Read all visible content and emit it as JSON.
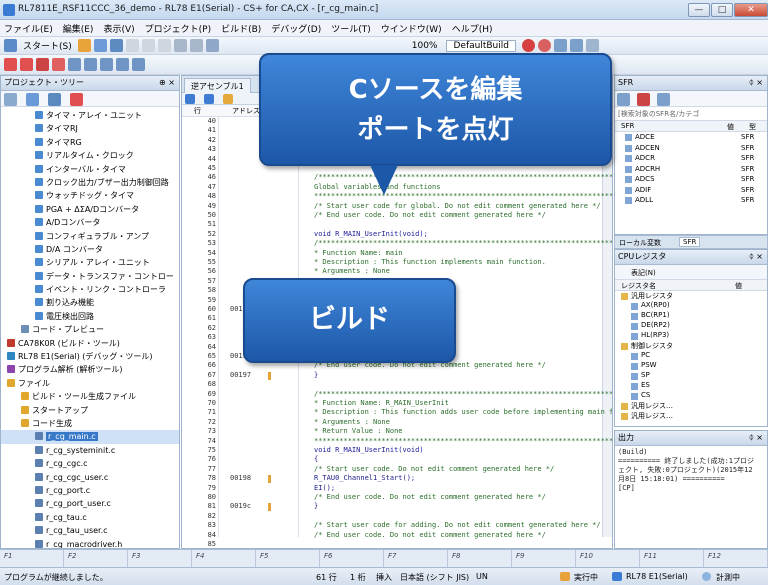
{
  "window": {
    "title": "RL7811E_RSF11CCC_36_demo - RL78 E1(Serial) - CS+ for CA,CX - [r_cg_main.c]",
    "min": "—",
    "max": "□",
    "close": "✕"
  },
  "menu": [
    "ファイル(E)",
    "編集(E)",
    "表示(V)",
    "プロジェクト(P)",
    "ビルド(B)",
    "デバッグ(D)",
    "ツール(T)",
    "ウインドウ(W)",
    "ヘルプ(H)"
  ],
  "toolbar": {
    "start_label": "スタート(S)",
    "zoom": "100%",
    "debug_label": "DefaultBuild"
  },
  "project_tree": {
    "title": "プロジェクト・ツリー",
    "items": [
      {
        "label": "タイマ・アレイ・ユニット",
        "indent": 2,
        "color": "#4a8ad0"
      },
      {
        "label": "タイマRJ",
        "indent": 2,
        "color": "#4a8ad0"
      },
      {
        "label": "タイマRG",
        "indent": 2,
        "color": "#4a8ad0"
      },
      {
        "label": "リアルタイム・クロック",
        "indent": 2,
        "color": "#4a8ad0"
      },
      {
        "label": "インターバル・タイマ",
        "indent": 2,
        "color": "#4a8ad0"
      },
      {
        "label": "クロック出力/ブザー出力制御回路",
        "indent": 2,
        "color": "#4a8ad0"
      },
      {
        "label": "ウォッチドッグ・タイマ",
        "indent": 2,
        "color": "#4a8ad0"
      },
      {
        "label": "PGA + ΔΣA/Dコンバータ",
        "indent": 2,
        "color": "#4a8ad0"
      },
      {
        "label": "A/Dコンバータ",
        "indent": 2,
        "color": "#4a8ad0"
      },
      {
        "label": "コンフィギュラブル・アンプ",
        "indent": 2,
        "color": "#4a8ad0"
      },
      {
        "label": "D/A コンバータ",
        "indent": 2,
        "color": "#4a8ad0"
      },
      {
        "label": "シリアル・アレイ・ユニット",
        "indent": 2,
        "color": "#4a8ad0"
      },
      {
        "label": "データ・トランスファ・コントロー",
        "indent": 2,
        "color": "#4a8ad0"
      },
      {
        "label": "イベント・リンク・コントローラ",
        "indent": 2,
        "color": "#4a8ad0"
      },
      {
        "label": "割り込み機能",
        "indent": 2,
        "color": "#4a8ad0"
      },
      {
        "label": "電圧検出回路",
        "indent": 2,
        "color": "#4a8ad0"
      },
      {
        "label": "コード・プレビュー",
        "indent": 1,
        "color": "#6d8fb5"
      },
      {
        "label": "CA78K0R (ビルド・ツール)",
        "indent": 0,
        "color": "#c0392b"
      },
      {
        "label": "RL78 E1(Serial) (デバッグ・ツール)",
        "indent": 0,
        "color": "#2e86c1"
      },
      {
        "label": "プログラム解析 (解析ツール)",
        "indent": 0,
        "color": "#8e44ad"
      },
      {
        "label": "ファイル",
        "indent": 0,
        "color": "#e1a72c"
      },
      {
        "label": "ビルド・ツール生成ファイル",
        "indent": 1,
        "color": "#e1a72c"
      },
      {
        "label": "スタートアップ",
        "indent": 1,
        "color": "#e1a72c"
      },
      {
        "label": "コード生成",
        "indent": 1,
        "color": "#e1a72c"
      },
      {
        "label": "r_cg_main.c",
        "indent": 2,
        "color": "#5a7fb0",
        "selected": true
      },
      {
        "label": "r_cg_systeminit.c",
        "indent": 2,
        "color": "#5a7fb0"
      },
      {
        "label": "r_cg_cgc.c",
        "indent": 2,
        "color": "#5a7fb0"
      },
      {
        "label": "r_cg_cgc_user.c",
        "indent": 2,
        "color": "#5a7fb0"
      },
      {
        "label": "r_cg_port.c",
        "indent": 2,
        "color": "#5a7fb0"
      },
      {
        "label": "r_cg_port_user.c",
        "indent": 2,
        "color": "#5a7fb0"
      },
      {
        "label": "r_cg_tau.c",
        "indent": 2,
        "color": "#5a7fb0"
      },
      {
        "label": "r_cg_tau_user.c",
        "indent": 2,
        "color": "#5a7fb0"
      },
      {
        "label": "r_cg_macrodriver.h",
        "indent": 2,
        "color": "#5a7fb0"
      }
    ]
  },
  "editor": {
    "tabs": [
      "逆アセンブル1",
      "r_cg_main.c"
    ],
    "header_label": "アドレス",
    "lines": [
      {
        "n": "40",
        "a": "",
        "c": "",
        "k": "code"
      },
      {
        "n": "41",
        "a": "",
        "c": "",
        "k": "code"
      },
      {
        "n": "42",
        "a": "",
        "c": "",
        "k": "code"
      },
      {
        "n": "43",
        "a": "",
        "c": "",
        "k": "code"
      },
      {
        "n": "44",
        "a": "",
        "c": "",
        "k": "code"
      },
      {
        "n": "45",
        "a": "",
        "c": "",
        "k": "code"
      },
      {
        "n": "46",
        "a": "",
        "c": "/*****************************************************************************",
        "k": "cm"
      },
      {
        "n": "47",
        "a": "",
        "c": "Global variables and functions",
        "k": "cm"
      },
      {
        "n": "48",
        "a": "",
        "c": "*****************************************************************************/",
        "k": "cm"
      },
      {
        "n": "49",
        "a": "",
        "c": "/* Start user code for global. Do not edit comment generated here */",
        "k": "cm"
      },
      {
        "n": "50",
        "a": "",
        "c": "/* End user code. Do not edit comment generated here */",
        "k": "cm"
      },
      {
        "n": "51",
        "a": "",
        "c": "",
        "k": "code"
      },
      {
        "n": "52",
        "a": "",
        "c": "void R_MAIN_UserInit(void);",
        "k": "kw"
      },
      {
        "n": "53",
        "a": "",
        "c": "/*****************************************************************************",
        "k": "cm"
      },
      {
        "n": "54",
        "a": "",
        "c": "* Function Name: main",
        "k": "cm"
      },
      {
        "n": "55",
        "a": "",
        "c": "* Description  : This function implements main function.",
        "k": "cm"
      },
      {
        "n": "56",
        "a": "",
        "c": "* Arguments    : None",
        "k": "cm"
      },
      {
        "n": "57",
        "a": "",
        "c": "",
        "k": "code"
      },
      {
        "n": "58",
        "a": "",
        "c": "",
        "k": "code"
      },
      {
        "n": "59",
        "a": "",
        "c": "",
        "k": "code"
      },
      {
        "n": "60",
        "a": "001",
        "c": "",
        "k": "code"
      },
      {
        "n": "61",
        "a": "",
        "c": "                              comment generated here */",
        "k": "cm"
      },
      {
        "n": "62",
        "a": "",
        "c": "",
        "k": "code"
      },
      {
        "n": "63",
        "a": "",
        "c": "",
        "k": "code"
      },
      {
        "n": "64",
        "a": "",
        "c": "",
        "k": "code"
      },
      {
        "n": "65",
        "a": "0019",
        "c": "",
        "k": "code"
      },
      {
        "n": "66",
        "a": "",
        "c": "    /* End user code. Do not edit comment generated here */",
        "k": "cm"
      },
      {
        "n": "67",
        "a": "00197",
        "c": "}",
        "k": "code"
      },
      {
        "n": "68",
        "a": "",
        "c": "",
        "k": "code"
      },
      {
        "n": "69",
        "a": "",
        "c": "/*****************************************************************************",
        "k": "cm"
      },
      {
        "n": "70",
        "a": "",
        "c": "* Function Name: R_MAIN_UserInit",
        "k": "cm"
      },
      {
        "n": "71",
        "a": "",
        "c": "* Description  : This function adds user code before implementing main fu",
        "k": "cm"
      },
      {
        "n": "72",
        "a": "",
        "c": "* Arguments    : None",
        "k": "cm"
      },
      {
        "n": "73",
        "a": "",
        "c": "* Return Value : None",
        "k": "cm"
      },
      {
        "n": "74",
        "a": "",
        "c": "*****************************************************************************/",
        "k": "cm"
      },
      {
        "n": "75",
        "a": "",
        "c": "void R_MAIN_UserInit(void)",
        "k": "kw"
      },
      {
        "n": "76",
        "a": "",
        "c": "{",
        "k": "code"
      },
      {
        "n": "77",
        "a": "",
        "c": "    /* Start user code. Do not edit comment generated here */",
        "k": "cm"
      },
      {
        "n": "78",
        "a": "00198",
        "c": "    R_TAU0_Channel1_Start();",
        "k": "code"
      },
      {
        "n": "79",
        "a": "",
        "c": "    EI();",
        "k": "code"
      },
      {
        "n": "80",
        "a": "",
        "c": "    /* End user code. Do not edit comment generated here */",
        "k": "cm"
      },
      {
        "n": "81",
        "a": "0019c",
        "c": "}",
        "k": "code"
      },
      {
        "n": "82",
        "a": "",
        "c": "",
        "k": "code"
      },
      {
        "n": "83",
        "a": "",
        "c": "/* Start user code for adding. Do not edit comment generated here */",
        "k": "cm"
      },
      {
        "n": "84",
        "a": "",
        "c": "/* End user code. Do not edit comment generated here */",
        "k": "cm"
      },
      {
        "n": "85",
        "a": "",
        "c": "",
        "k": "code"
      }
    ]
  },
  "sfr_panel": {
    "title": "SFR",
    "filter": "[検索対象のSFR名/カテゴ",
    "header_name": "SFR",
    "header_value": "値",
    "header_type": "型",
    "rows": [
      {
        "name": "ADCE",
        "type": "SFR"
      },
      {
        "name": "ADCEN",
        "type": "SFR"
      },
      {
        "name": "ADCR",
        "type": "SFR"
      },
      {
        "name": "ADCRH",
        "type": "SFR"
      },
      {
        "name": "ADCS",
        "type": "SFR"
      },
      {
        "name": "ADIF",
        "type": "SFR"
      },
      {
        "name": "ADLL",
        "type": "SFR"
      }
    ],
    "tabs": [
      "ローカル変数",
      "SFR"
    ]
  },
  "cpu_panel": {
    "title": "CPUレジスタ",
    "notation": "表記(N)",
    "header_name": "レジスタ名",
    "header_value": "値",
    "rows": [
      {
        "label": "汎用レジスタ",
        "level": 0
      },
      {
        "label": "AX(RP0)",
        "level": 1
      },
      {
        "label": "BC(RP1)",
        "level": 1
      },
      {
        "label": "DE(RP2)",
        "level": 1
      },
      {
        "label": "HL(RP3)",
        "level": 1
      },
      {
        "label": "制御レジスタ",
        "level": 0
      },
      {
        "label": "PC",
        "level": 1
      },
      {
        "label": "PSW",
        "level": 1
      },
      {
        "label": "SP",
        "level": 1
      },
      {
        "label": "ES",
        "level": 1
      },
      {
        "label": "CS",
        "level": 1
      },
      {
        "label": "汎用レジス…",
        "level": 0
      },
      {
        "label": "汎用レジス…",
        "level": 0
      }
    ]
  },
  "output_panel": {
    "title": "出力",
    "lines": [
      "(Build)",
      "========== 終了しました(成功:1プロジ",
      "ェクト, 失敗:0プロジェクト)(2015年12",
      "月8日 15:18:01) ==========",
      "[CP]"
    ]
  },
  "fkeys": [
    "F1",
    "F2",
    "F3",
    "F4",
    "F5",
    "F6",
    "F7",
    "F8",
    "F9",
    "F10",
    "F11",
    "F12"
  ],
  "status": {
    "message": "プログラムが継続しました。",
    "line": "61 行",
    "col": "1 桁",
    "mode": "挿入",
    "encoding": "日本語 (シフト JIS)",
    "eol": "UN",
    "run_state": "実行中",
    "target": "RL78 E1(Serial)",
    "timer": "計測中"
  },
  "callouts": {
    "edit_line1": "Cソースを編集",
    "edit_line2": "ポートを点灯",
    "build": "ビルド"
  }
}
